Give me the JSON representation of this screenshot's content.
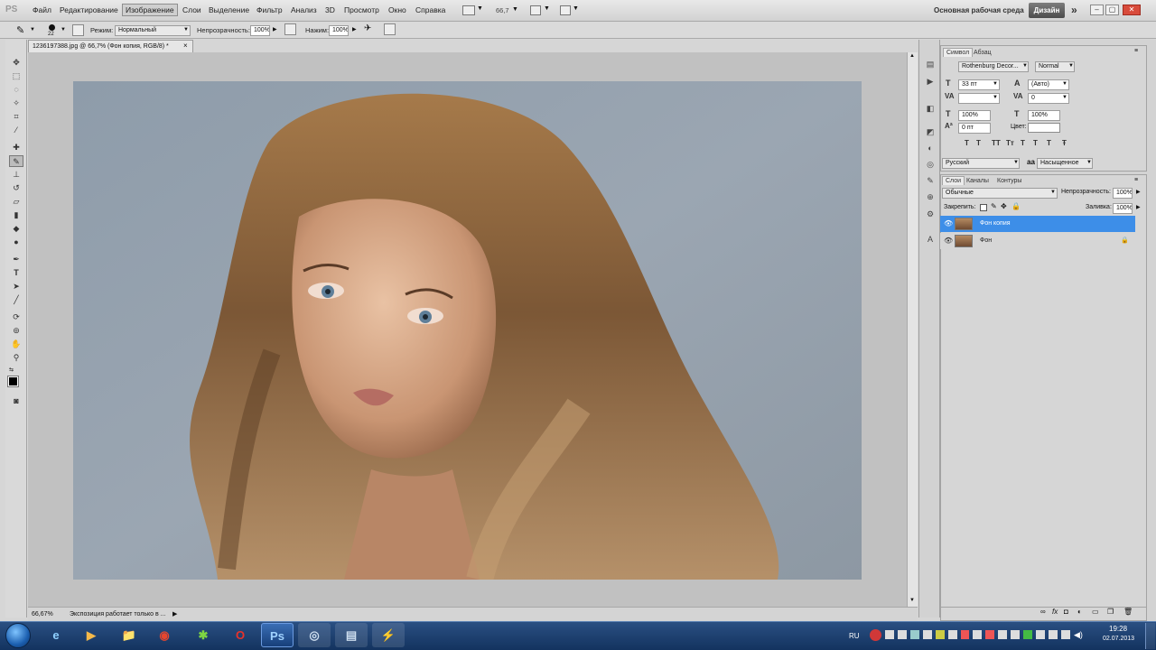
{
  "app": {
    "logo": "PS"
  },
  "menu": [
    "Файл",
    "Редактирование",
    "Изображение",
    "Слои",
    "Выделение",
    "Фильтр",
    "Анализ",
    "3D",
    "Просмотр",
    "Окно",
    "Справка"
  ],
  "menu_active": "Изображение",
  "toolbar_right": {
    "zoom": "66,7"
  },
  "workspace": {
    "label": "Основная рабочая среда",
    "design": "Дизайн",
    "more": "»"
  },
  "window_controls": {
    "minimize": "–",
    "restore": "▢",
    "close": "✕"
  },
  "options_bar": {
    "brush_size": "22",
    "mode_label": "Режим:",
    "mode_value": "Нормальный",
    "opacity_label": "Непрозрачность:",
    "opacity_value": "100%",
    "flow_label": "Нажим:",
    "flow_value": "100%"
  },
  "document": {
    "tab_title": "1236197388.jpg @ 66,7% (Фон копия, RGB/8) *",
    "tab_close": "×"
  },
  "status": {
    "zoom": "66,67%",
    "info": "Экспозиция работает только в ...",
    "arrow": "▶"
  },
  "character_panel": {
    "tabs": [
      "Символ",
      "Абзац"
    ],
    "font_family": "Rothenburg Decor...",
    "font_style": "Normal",
    "size": "33 пт",
    "leading": "(Авто)",
    "tracking": "0",
    "kerning": "",
    "vscale": "100%",
    "hscale": "100%",
    "baseline": "0 пт",
    "color_label": "Цвет:",
    "style_buttons": [
      "T",
      "T",
      "TT",
      "Tт",
      "T",
      "T",
      "T",
      "Ŧ"
    ],
    "language": "Русский",
    "antialias_icon": "aа",
    "antialias": "Насыщенное"
  },
  "layers_panel": {
    "tabs": [
      "Слои",
      "Каналы",
      "Контуры"
    ],
    "blend_mode": "Обычные",
    "opacity_label": "Непрозрачность:",
    "opacity_value": "100%",
    "lock_label": "Закрепить:",
    "fill_label": "Заливка:",
    "fill_value": "100%",
    "layers": [
      {
        "name": "Фон копия",
        "selected": true,
        "locked": false
      },
      {
        "name": "Фон",
        "selected": false,
        "locked": true
      }
    ]
  },
  "taskbar": {
    "language": "RU",
    "time": "19:28",
    "date": "02.07.2013",
    "apps": [
      "e",
      "▶",
      "📁",
      "◉",
      "✱",
      "O",
      "Ps",
      "◎",
      "▤",
      "⚡"
    ]
  },
  "colors": {
    "accent_selected_layer": "#3d8ee8",
    "taskbar": "#1c3e6e",
    "chrome": "#d6d6d6"
  }
}
